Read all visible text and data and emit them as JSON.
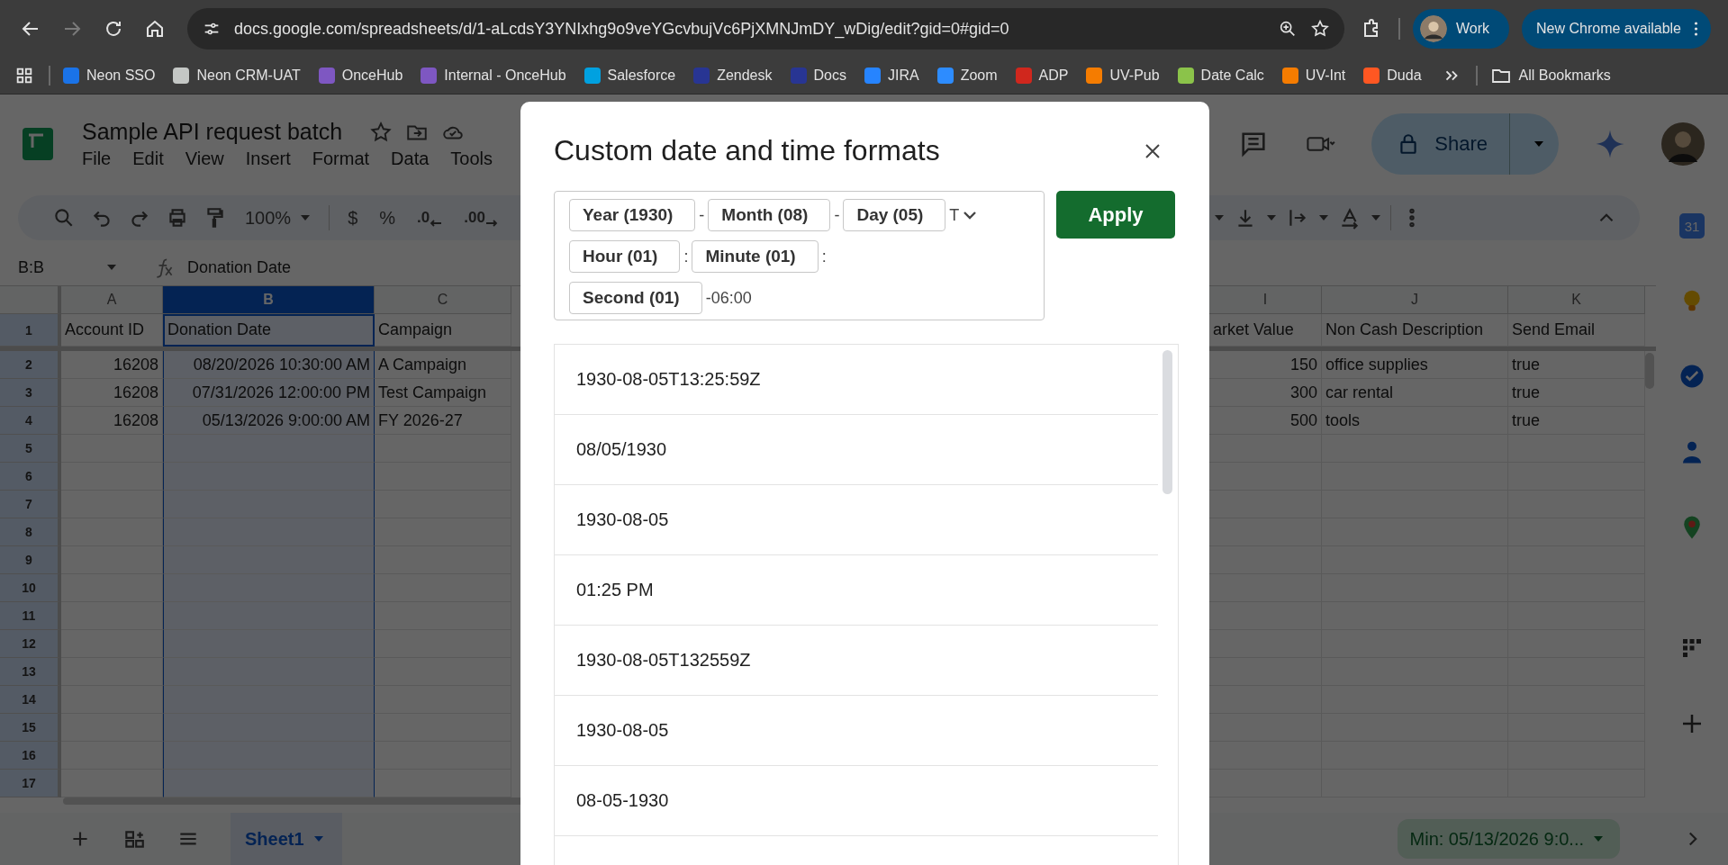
{
  "browser": {
    "url": "docs.google.com/spreadsheets/d/1-aLcdsY3YNIxhg9o9veYGcvbujVc6PjXMNJmDY_wDig/edit?gid=0#gid=0",
    "forward_disabled": true,
    "profile": "Work",
    "update_button": "New Chrome available"
  },
  "bookmarks": [
    {
      "label": "Neon SSO",
      "color": "#1a73e8"
    },
    {
      "label": "Neon CRM-UAT",
      "color": "#c4c7c5"
    },
    {
      "label": "OnceHub",
      "color": "#7e57c2"
    },
    {
      "label": "Internal - OnceHub",
      "color": "#7e57c2"
    },
    {
      "label": "Salesforce",
      "color": "#00a1e0"
    },
    {
      "label": "Zendesk",
      "color": "#283593"
    },
    {
      "label": "Docs",
      "color": "#283593"
    },
    {
      "label": "JIRA",
      "color": "#2684ff"
    },
    {
      "label": "Zoom",
      "color": "#2d8cff"
    },
    {
      "label": "ADP",
      "color": "#d0271d"
    },
    {
      "label": "UV-Pub",
      "color": "#f57c00"
    },
    {
      "label": "Date Calc",
      "color": "#8bc34a"
    },
    {
      "label": "UV-Int",
      "color": "#f57c00"
    },
    {
      "label": "Duda",
      "color": "#ff5722"
    }
  ],
  "all_bookmarks": "All Bookmarks",
  "doc": {
    "title": "Sample API request batch",
    "menu": [
      "File",
      "Edit",
      "View",
      "Insert",
      "Format",
      "Data",
      "Tools"
    ],
    "share": "Share"
  },
  "toolbar": {
    "zoom": "100%",
    "currency": "$",
    "percent": "%",
    "decrease_decimal": ".0",
    "increase_decimal": ".00"
  },
  "formula_bar": {
    "name_box": "B:B",
    "content": "Donation Date"
  },
  "grid": {
    "columns": [
      {
        "label": "A",
        "selected": false
      },
      {
        "label": "B",
        "selected": true
      },
      {
        "label": "C",
        "selected": false
      },
      {
        "label": "I",
        "selected": false
      },
      {
        "label": "J",
        "selected": false
      },
      {
        "label": "K",
        "selected": false
      }
    ],
    "rows": [
      {
        "number": "1",
        "cells": [
          {
            "text": "Account ID",
            "kind": "text",
            "selected": false
          },
          {
            "text": "Donation Date",
            "kind": "text",
            "selected": true
          },
          {
            "text": "Campaign",
            "kind": "text",
            "selected": false
          },
          {
            "text": "arket Value",
            "kind": "text",
            "selected": false
          },
          {
            "text": "Non Cash Description",
            "kind": "text",
            "selected": false
          },
          {
            "text": "Send Email",
            "kind": "text",
            "selected": false
          }
        ]
      },
      {
        "number": "2",
        "cells": [
          {
            "text": "16208",
            "kind": "number",
            "selected": false
          },
          {
            "text": "08/20/2026 10:30:00 AM",
            "kind": "number",
            "selected": false
          },
          {
            "text": "A Campaign",
            "kind": "text",
            "selected": false
          },
          {
            "text": "150",
            "kind": "number",
            "selected": false
          },
          {
            "text": "office supplies",
            "kind": "text",
            "selected": false
          },
          {
            "text": "true",
            "kind": "text",
            "selected": false
          }
        ]
      },
      {
        "number": "3",
        "cells": [
          {
            "text": "16208",
            "kind": "number",
            "selected": false
          },
          {
            "text": "07/31/2026 12:00:00 PM",
            "kind": "number",
            "selected": false
          },
          {
            "text": "Test Campaign",
            "kind": "text",
            "selected": false
          },
          {
            "text": "300",
            "kind": "number",
            "selected": false
          },
          {
            "text": "car rental",
            "kind": "text",
            "selected": false
          },
          {
            "text": "true",
            "kind": "text",
            "selected": false
          }
        ]
      },
      {
        "number": "4",
        "cells": [
          {
            "text": "16208",
            "kind": "number",
            "selected": false
          },
          {
            "text": "05/13/2026 9:00:00 AM",
            "kind": "number",
            "selected": false
          },
          {
            "text": "FY 2026-27",
            "kind": "text",
            "selected": false
          },
          {
            "text": "500",
            "kind": "number",
            "selected": false
          },
          {
            "text": "tools",
            "kind": "text",
            "selected": false
          },
          {
            "text": "true",
            "kind": "text",
            "selected": false
          }
        ]
      },
      {
        "number": "5"
      },
      {
        "number": "6"
      },
      {
        "number": "7"
      },
      {
        "number": "8"
      },
      {
        "number": "9"
      },
      {
        "number": "10"
      },
      {
        "number": "11"
      },
      {
        "number": "12"
      },
      {
        "number": "13"
      },
      {
        "number": "14"
      },
      {
        "number": "15"
      },
      {
        "number": "16"
      },
      {
        "number": "17"
      }
    ]
  },
  "side_panel": {
    "calendar_day": "31"
  },
  "sheets": [
    {
      "label": "Sheet1",
      "selected": true
    }
  ],
  "status": "Min: 05/13/2026 9:0...",
  "dialog": {
    "title": "Custom date and time formats",
    "apply": "Apply",
    "lines": [
      [
        {
          "kind": "chip",
          "text": "Year (1930)"
        },
        {
          "kind": "sep",
          "text": "-"
        },
        {
          "kind": "chip",
          "text": "Month (08)"
        },
        {
          "kind": "sep",
          "text": "-"
        },
        {
          "kind": "chip",
          "text": "Day (05)"
        },
        {
          "kind": "sep",
          "text": "T"
        }
      ],
      [
        {
          "kind": "chip",
          "text": "Hour (01)"
        },
        {
          "kind": "sep",
          "text": ":"
        },
        {
          "kind": "chip",
          "text": "Minute (01)"
        },
        {
          "kind": "sep",
          "text": ":"
        }
      ],
      [
        {
          "kind": "chip",
          "text": "Second (01)"
        },
        {
          "kind": "sep",
          "text": "-06:00"
        }
      ]
    ],
    "options": [
      "1930-08-05T13:25:59Z",
      "08/05/1930",
      "1930-08-05",
      "01:25 PM",
      "1930-08-05T132559Z",
      "1930-08-05",
      "08-05-1930"
    ]
  }
}
